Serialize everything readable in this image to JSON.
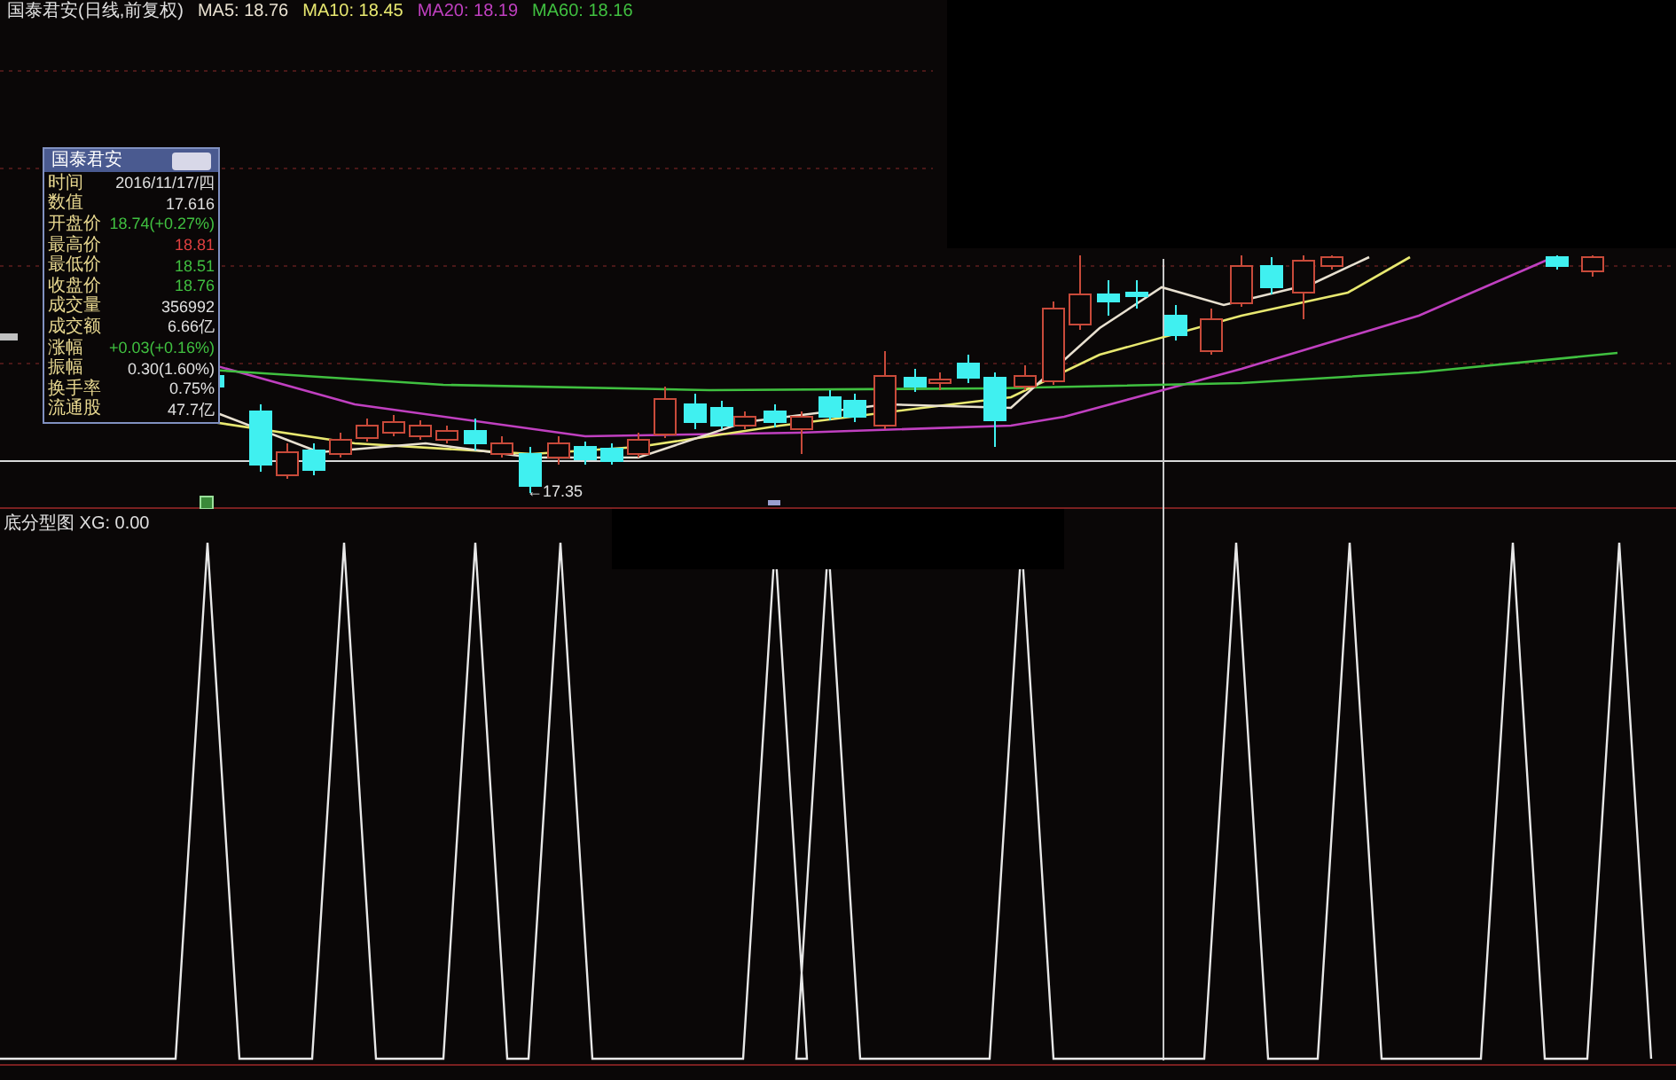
{
  "chart_header": {
    "security": "国泰君安(日线,前复权)",
    "indicators": [
      {
        "label": "MA5: 18.76",
        "color": "#e8e0d0"
      },
      {
        "label": "MA10: 18.45",
        "color": "#e8e870"
      },
      {
        "label": "MA20: 18.19",
        "color": "#c040c0"
      },
      {
        "label": "MA60: 18.16",
        "color": "#40c040"
      }
    ]
  },
  "info_panel": {
    "title": "国泰君安",
    "rows": [
      {
        "label": "时间",
        "value": "2016/11/17/四",
        "color": "#e0e0e0"
      },
      {
        "label": "数值",
        "value": "17.616",
        "color": "#e0e0e0"
      },
      {
        "label": "开盘价",
        "value": "18.74(+0.27%)",
        "color": "#40c040"
      },
      {
        "label": "最高价",
        "value": "18.81",
        "color": "#e04040"
      },
      {
        "label": "最低价",
        "value": "18.51",
        "color": "#40c040"
      },
      {
        "label": "收盘价",
        "value": "18.76",
        "color": "#40c040"
      },
      {
        "label": "成交量",
        "value": "356992",
        "color": "#e0e0e0"
      },
      {
        "label": "成交额",
        "value": "6.66亿",
        "color": "#e0e0e0"
      },
      {
        "label": "涨幅",
        "value": "+0.03(+0.16%)",
        "color": "#40c040"
      },
      {
        "label": "振幅",
        "value": "0.30(1.60%)",
        "color": "#e0e0e0"
      },
      {
        "label": "换手率",
        "value": "0.75%",
        "color": "#e0e0e0"
      },
      {
        "label": "流通股",
        "value": "47.7亿",
        "color": "#e0e0e0"
      }
    ]
  },
  "low_marker": "←17.35",
  "subchart": {
    "label": "底分型图 XG: 0.00"
  }
}
